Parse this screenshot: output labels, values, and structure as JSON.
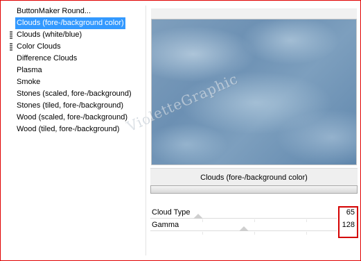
{
  "filters": {
    "items": [
      {
        "label": "ButtonMaker Round...",
        "selected": false,
        "grip": false
      },
      {
        "label": "Clouds (fore-/background color)",
        "selected": true,
        "grip": false
      },
      {
        "label": "Clouds (white/blue)",
        "selected": false,
        "grip": true
      },
      {
        "label": "Color Clouds",
        "selected": false,
        "grip": true
      },
      {
        "label": "Difference Clouds",
        "selected": false,
        "grip": false
      },
      {
        "label": "Plasma",
        "selected": false,
        "grip": false
      },
      {
        "label": "Smoke",
        "selected": false,
        "grip": false
      },
      {
        "label": "Stones (scaled, fore-/background)",
        "selected": false,
        "grip": false
      },
      {
        "label": "Stones (tiled, fore-/background)",
        "selected": false,
        "grip": false
      },
      {
        "label": "Wood (scaled, fore-/background)",
        "selected": false,
        "grip": false
      },
      {
        "label": "Wood (tiled, fore-/background)",
        "selected": false,
        "grip": false
      }
    ]
  },
  "preview": {
    "watermark": "VioletteGraphic"
  },
  "filter_title": "Clouds (fore-/background color)",
  "params": [
    {
      "label": "Cloud Type",
      "value": "65",
      "max": 255
    },
    {
      "label": "Gamma",
      "value": "128",
      "max": 255
    }
  ],
  "colors": {
    "selection": "#3399ff",
    "highlight_border": "#d40000",
    "frame_border": "#e00000"
  },
  "icons": {
    "grip": "drag-grip-icon",
    "thumb": "slider-thumb-icon"
  }
}
